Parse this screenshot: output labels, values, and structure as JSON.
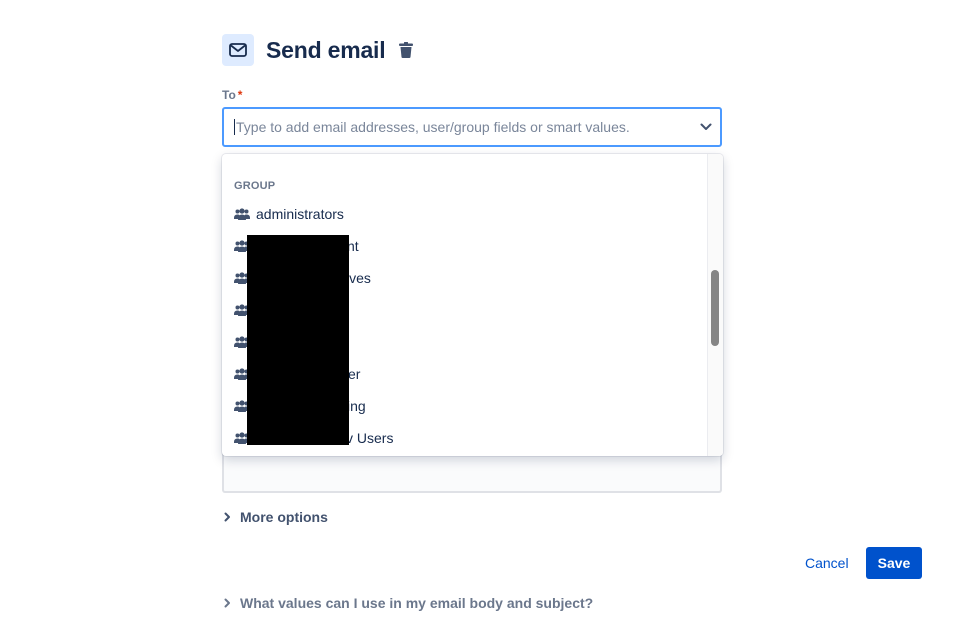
{
  "header": {
    "icon": "mail-icon",
    "title": "Send email",
    "delete_icon": "trash-icon"
  },
  "to_field": {
    "label": "To",
    "required_marker": "*",
    "value": "",
    "placeholder": "Type to add email addresses, user/group fields or smart values.",
    "dropdown_icon": "chevron-down-icon"
  },
  "dropdown": {
    "group_heading": "GROUP",
    "items": [
      {
        "label": "administrators",
        "icon": "people-group-icon"
      },
      {
        "label": "nt",
        "icon": "people-group-icon"
      },
      {
        "label": "ives",
        "icon": "people-group-icon"
      },
      {
        "label": "",
        "icon": "people-group-icon"
      },
      {
        "label": "",
        "icon": "people-group-icon"
      },
      {
        "label": "er",
        "icon": "people-group-icon"
      },
      {
        "label": "ing",
        "icon": "people-group-icon"
      },
      {
        "label": "v Users",
        "icon": "people-group-icon"
      }
    ]
  },
  "more_options": {
    "label": "More options",
    "icon": "chevron-right-icon"
  },
  "actions": {
    "cancel": "Cancel",
    "save": "Save"
  },
  "help": {
    "label": "What values can I use in my email body and subject?",
    "icon": "chevron-right-icon"
  },
  "colors": {
    "accent": "#0052cc",
    "focus_border": "#4c9aff",
    "icon_tile": "#deebff",
    "text_primary": "#172b4d",
    "text_subtle": "#6b778c",
    "required": "#de350b"
  }
}
